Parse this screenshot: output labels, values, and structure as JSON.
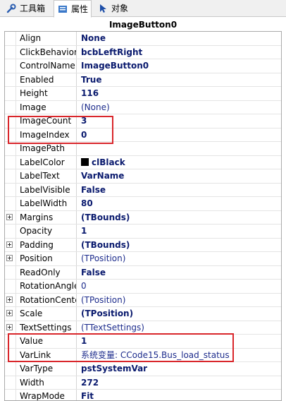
{
  "tabs": [
    {
      "label": "工具箱",
      "icon": "wrench-icon"
    },
    {
      "label": "属性",
      "icon": "properties-icon",
      "active": true
    },
    {
      "label": "对象",
      "icon": "pointer-icon"
    }
  ],
  "title": "ImageButton0",
  "properties": [
    {
      "name": "Align",
      "value": "None",
      "style": "bold"
    },
    {
      "name": "ClickBehavior",
      "value": "bcbLeftRight",
      "style": "bold"
    },
    {
      "name": "ControlName",
      "value": "ImageButton0",
      "style": "bold"
    },
    {
      "name": "Enabled",
      "value": "True",
      "style": "bold"
    },
    {
      "name": "Height",
      "value": "116",
      "style": "bold"
    },
    {
      "name": "Image",
      "value": "(None)",
      "style": "normal"
    },
    {
      "name": "ImageCount",
      "value": "3",
      "style": "bold"
    },
    {
      "name": "ImageIndex",
      "value": "0",
      "style": "bold"
    },
    {
      "name": "ImagePath",
      "value": "",
      "style": "normal"
    },
    {
      "name": "LabelColor",
      "value": "clBlack",
      "style": "bold",
      "swatch": "#000000"
    },
    {
      "name": "LabelText",
      "value": "VarName",
      "style": "bold"
    },
    {
      "name": "LabelVisible",
      "value": "False",
      "style": "bold"
    },
    {
      "name": "LabelWidth",
      "value": "80",
      "style": "bold"
    },
    {
      "name": "Margins",
      "value": "(TBounds)",
      "style": "bold",
      "expandable": true
    },
    {
      "name": "Opacity",
      "value": "1",
      "style": "bold"
    },
    {
      "name": "Padding",
      "value": "(TBounds)",
      "style": "bold",
      "expandable": true
    },
    {
      "name": "Position",
      "value": "(TPosition)",
      "style": "normal",
      "expandable": true
    },
    {
      "name": "ReadOnly",
      "value": "False",
      "style": "bold"
    },
    {
      "name": "RotationAngle",
      "value": "0",
      "style": "normal"
    },
    {
      "name": "RotationCenter",
      "value": "(TPosition)",
      "style": "normal",
      "expandable": true
    },
    {
      "name": "Scale",
      "value": "(TPosition)",
      "style": "bold",
      "expandable": true
    },
    {
      "name": "TextSettings",
      "value": "(TTextSettings)",
      "style": "normal",
      "expandable": true
    },
    {
      "name": "Value",
      "value": "1",
      "style": "bold"
    },
    {
      "name": "VarLink",
      "value": "系统变量: CCode15.Bus_load_status",
      "style": "normal"
    },
    {
      "name": "VarType",
      "value": "pstSystemVar",
      "style": "bold"
    },
    {
      "name": "Width",
      "value": "272",
      "style": "bold"
    },
    {
      "name": "WrapMode",
      "value": "Fit",
      "style": "bold"
    }
  ],
  "colors": {
    "highlight": "#d9262b",
    "value_blue": "#0a1a6e",
    "tab_bar": "#f0f0f0"
  }
}
